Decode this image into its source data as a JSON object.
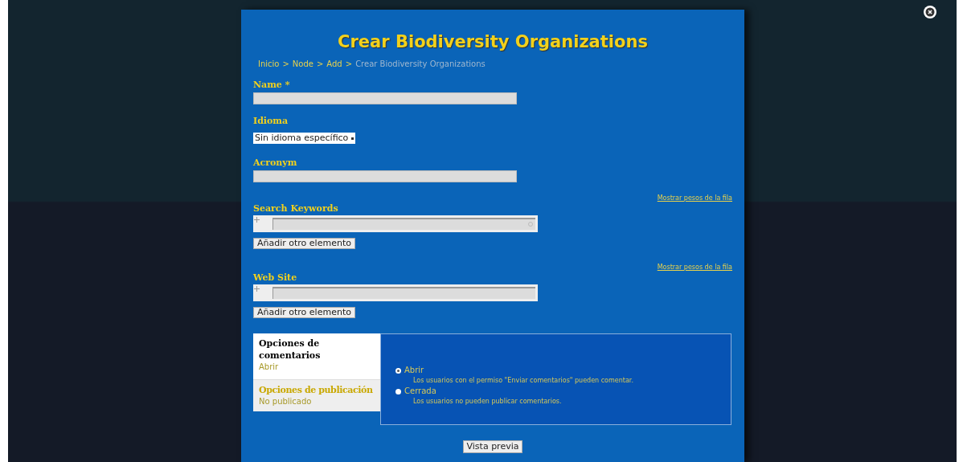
{
  "title": "Crear Biodiversity Organizations",
  "breadcrumb": [
    {
      "label": "Inicio",
      "current": false
    },
    {
      "label": "Node",
      "current": false
    },
    {
      "label": "Add",
      "current": false
    },
    {
      "label": "Crear Biodiversity Organizations",
      "current": true
    }
  ],
  "separator": ">",
  "fields": [
    {
      "kind": "text",
      "label": "Name *"
    },
    {
      "kind": "select",
      "label": "Idioma",
      "value": "Sin idioma específico"
    },
    {
      "kind": "text",
      "label": "Acronym"
    },
    {
      "kind": "multi",
      "label": "Search Keywords",
      "weights_link": "Mostrar pesos de la fila",
      "add_button": "Añadir otro elemento",
      "autocomplete": true
    },
    {
      "kind": "multi",
      "label": "Web Site",
      "weights_link": "Mostrar pesos de la fila",
      "add_button": "Añadir otro elemento",
      "autocomplete": false
    }
  ],
  "vertical_tabs": [
    {
      "title": "Opciones de comentarios",
      "summary": "Abrir",
      "selected": true
    },
    {
      "title": "Opciones de publicación",
      "summary": "No publicado",
      "selected": false
    }
  ],
  "comment_options": [
    {
      "label": "Abrir",
      "description": "Los usuarios con el permiso \"Enviar comentarios\" pueden comentar.",
      "selected": true
    },
    {
      "label": "Cerrada",
      "description": "Los usuarios no pueden publicar comentarios.",
      "selected": false
    }
  ],
  "preview_button": "Vista previa"
}
